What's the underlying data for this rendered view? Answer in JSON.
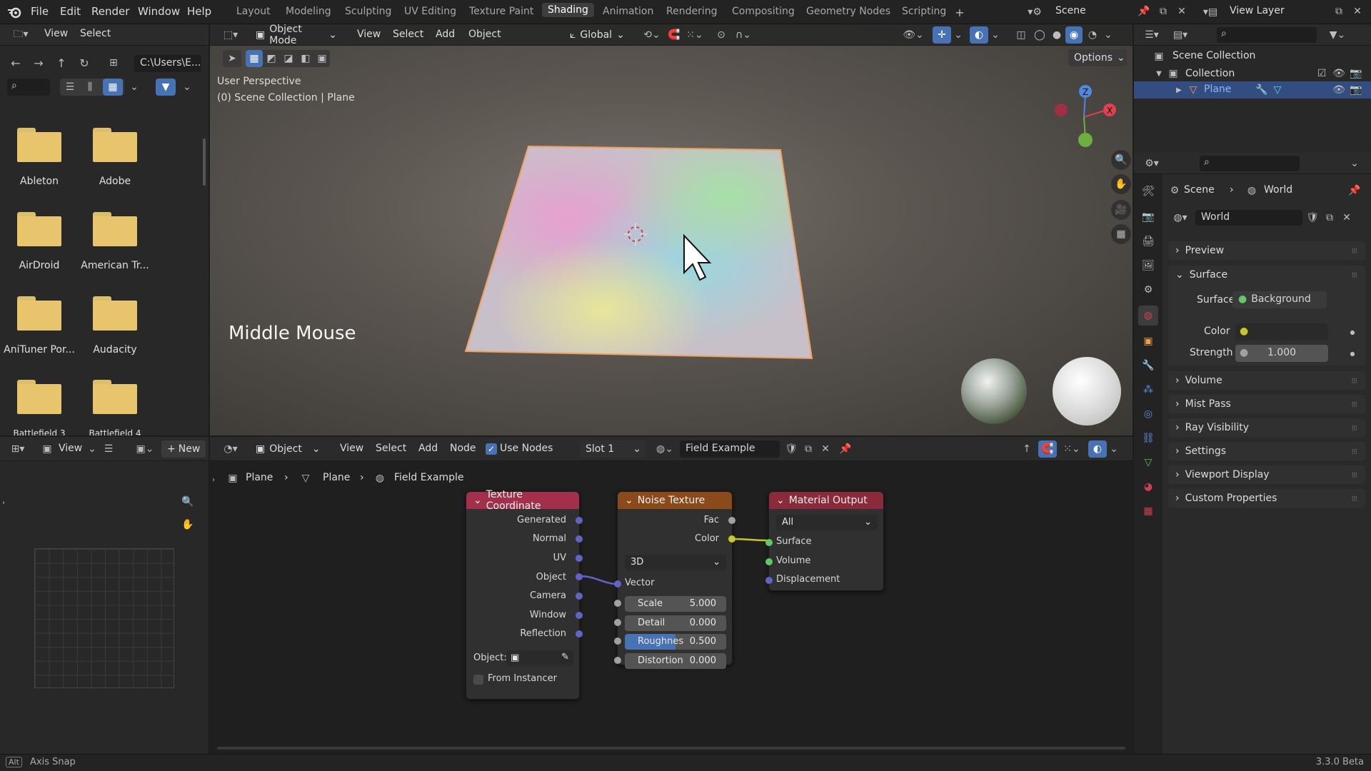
{
  "menu": [
    "File",
    "Edit",
    "Render",
    "Window",
    "Help"
  ],
  "workspaces": [
    "Layout",
    "Modeling",
    "Sculpting",
    "UV Editing",
    "Texture Paint",
    "Shading",
    "Animation",
    "Rendering",
    "Compositing",
    "Geometry Nodes",
    "Scripting"
  ],
  "active_workspace": "Shading",
  "scene_name": "Scene",
  "view_layer": "View Layer",
  "file_browser": {
    "menus": [
      "View",
      "Select"
    ],
    "path": "C:\\Users\\E...",
    "folders": [
      "Ableton",
      "Adobe",
      "AirDroid",
      "American Tr...",
      "AniTuner Por...",
      "Audacity",
      "Battlefield 3",
      "Battlefield 4"
    ]
  },
  "viewport": {
    "mode": "Object Mode",
    "menus": [
      "View",
      "Select",
      "Add",
      "Object"
    ],
    "orientation": "Global",
    "options": "Options",
    "perspective": "User Perspective",
    "collection_info": "(0) Scene Collection | Plane",
    "overlay_text": "Middle Mouse",
    "gizmo": {
      "z": "Z",
      "x": "X"
    }
  },
  "outliner": {
    "scene_collection": "Scene Collection",
    "collection": "Collection",
    "object": "Plane"
  },
  "properties": {
    "breadcrumb_scene": "Scene",
    "breadcrumb_world": "World",
    "world_name": "World",
    "panels": [
      "Preview",
      "Surface",
      "Volume",
      "Mist Pass",
      "Ray Visibility",
      "Settings",
      "Viewport Display",
      "Custom Properties"
    ],
    "surface_label": "Surface",
    "surface_value": "Background",
    "color_label": "Color",
    "strength_label": "Strength",
    "strength_value": "1.000"
  },
  "image_editor": {
    "view": "View",
    "new": "New"
  },
  "node_editor": {
    "type": "Object",
    "menus": [
      "View",
      "Select",
      "Add",
      "Node"
    ],
    "use_nodes": "Use Nodes",
    "slot": "Slot 1",
    "material": "Field Example",
    "breadcrumb": [
      "Plane",
      "Plane",
      "Field Example"
    ]
  },
  "nodes": {
    "tex_coord": {
      "title": "Texture Coordinate",
      "outputs": [
        "Generated",
        "Normal",
        "UV",
        "Object",
        "Camera",
        "Window",
        "Reflection"
      ],
      "object_label": "Object:",
      "from_instancer": "From Instancer"
    },
    "noise": {
      "title": "Noise Texture",
      "outputs": [
        "Fac",
        "Color"
      ],
      "dimension": "3D",
      "vector": "Vector",
      "fields": [
        {
          "label": "Scale",
          "value": "5.000"
        },
        {
          "label": "Detail",
          "value": "0.000"
        },
        {
          "label": "Roughnes",
          "value": "0.500"
        },
        {
          "label": "Distortion",
          "value": "0.000"
        }
      ]
    },
    "output": {
      "title": "Material Output",
      "target": "All",
      "inputs": [
        "Surface",
        "Volume",
        "Displacement"
      ]
    }
  },
  "status": {
    "key": "Alt",
    "hint": "Axis Snap",
    "version": "3.3.0 Beta"
  },
  "colors": {
    "accent": "#4772b3",
    "node_texcoord": "#a2304a",
    "node_noise": "#8a4a1a",
    "node_output": "#8a2a3a",
    "socket_vector": "#6363c7",
    "socket_color": "#c7c729",
    "socket_shader": "#63c763",
    "socket_gray": "#a1a1a1"
  }
}
